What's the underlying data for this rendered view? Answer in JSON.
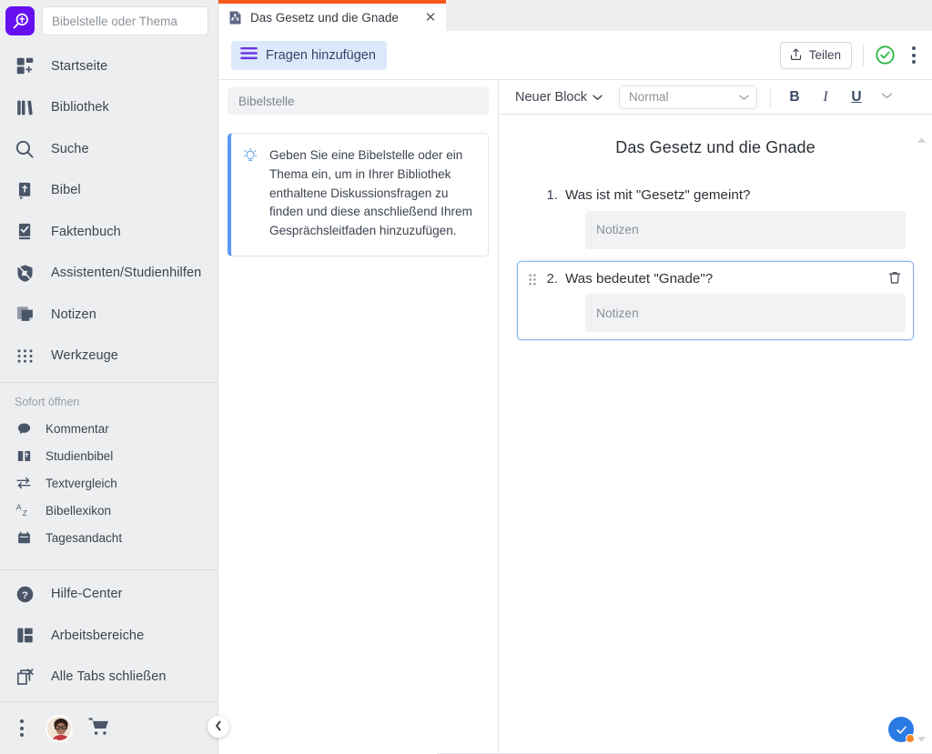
{
  "app": {
    "logo_icon": "logos-magnifier-cross-icon",
    "accent_orange": "#f4581c",
    "accent_purple": "#6610f2",
    "accent_blue": "#2a7ae4"
  },
  "sidebar": {
    "search": {
      "placeholder": "Bibelstelle oder Thema",
      "value": ""
    },
    "nav_items": [
      {
        "label": "Startseite",
        "icon": "home-dashboard-icon"
      },
      {
        "label": "Bibliothek",
        "icon": "library-books-icon"
      },
      {
        "label": "Suche",
        "icon": "search-icon"
      },
      {
        "label": "Bibel",
        "icon": "bible-book-icon"
      },
      {
        "label": "Faktenbuch",
        "icon": "factbook-check-icon"
      },
      {
        "label": "Assistenten/Studienhilfen",
        "icon": "guides-compass-icon"
      },
      {
        "label": "Notizen",
        "icon": "notes-stack-icon"
      },
      {
        "label": "Werkzeuge",
        "icon": "tools-grid-icon"
      }
    ],
    "quick_header": "Sofort öffnen",
    "quick_items": [
      {
        "label": "Kommentar",
        "icon": "comment-bubble-icon"
      },
      {
        "label": "Studienbibel",
        "icon": "study-bible-icon"
      },
      {
        "label": "Textvergleich",
        "icon": "text-compare-arrows-icon"
      },
      {
        "label": "Bibellexikon",
        "icon": "bible-dictionary-az-icon"
      },
      {
        "label": "Tagesandacht",
        "icon": "daily-devotional-calendar-icon"
      }
    ],
    "bottom_items": [
      {
        "label": "Hilfe-Center",
        "icon": "help-question-icon"
      },
      {
        "label": "Arbeitsbereiche",
        "icon": "layouts-panels-icon"
      },
      {
        "label": "Alle Tabs schließen",
        "icon": "close-all-tabs-icon"
      }
    ],
    "footer": {
      "more_icon": "kebab-menu-icon",
      "avatar_icon": "user-avatar",
      "cart_icon": "shopping-cart-icon"
    },
    "collapse_icon": "chevron-left-icon"
  },
  "tabbar": {
    "tabs": [
      {
        "title": "Das Gesetz und die Gnade",
        "icon": "sermon-document-icon",
        "close_icon": "close-icon",
        "active": true
      }
    ]
  },
  "toolbar": {
    "add_questions_label": "Fragen hinzufügen",
    "add_questions_icon": "hamburger-lines-icon",
    "share_label": "Teilen",
    "share_icon": "share-upload-icon",
    "status_icon": "check-circle-green-icon",
    "more_icon": "kebab-menu-icon"
  },
  "left_pane": {
    "search": {
      "placeholder": "Bibelstelle",
      "value": ""
    },
    "hint": {
      "icon": "lightbulb-icon",
      "text": "Geben Sie eine Bibelstelle oder ein Thema ein, um in Ihrer Bibliothek enthaltene Diskussionsfragen zu finden und diese anschließend Ihrem Gesprächsleitfaden hinzuzufügen."
    }
  },
  "editor": {
    "toolbar": {
      "new_block_label": "Neuer Block",
      "new_block_chevron": "chevron-down-icon",
      "style_value": "Normal",
      "style_chevron": "chevron-down-icon",
      "bold_label": "B",
      "italic_label": "I",
      "underline_label": "U",
      "more_formats_icon": "chevron-double-down-icon"
    },
    "document_title": "Das Gesetz und die Gnade",
    "questions": [
      {
        "number": "1.",
        "text": "Was ist mit \"Gesetz\" gemeint?",
        "notes_placeholder": "Notizen",
        "notes_value": "",
        "selected": false
      },
      {
        "number": "2.",
        "text": "Was bedeutet \"Gnade\"?",
        "notes_placeholder": "Notizen",
        "notes_value": "",
        "selected": true,
        "grip_icon": "drag-handle-icon",
        "delete_icon": "trash-icon"
      }
    ],
    "scroll_up_icon": "scroll-up-arrow-icon",
    "scroll_down_icon": "scroll-down-arrow-icon",
    "fab": {
      "icon": "check-icon",
      "badge": "notification-dot"
    }
  }
}
